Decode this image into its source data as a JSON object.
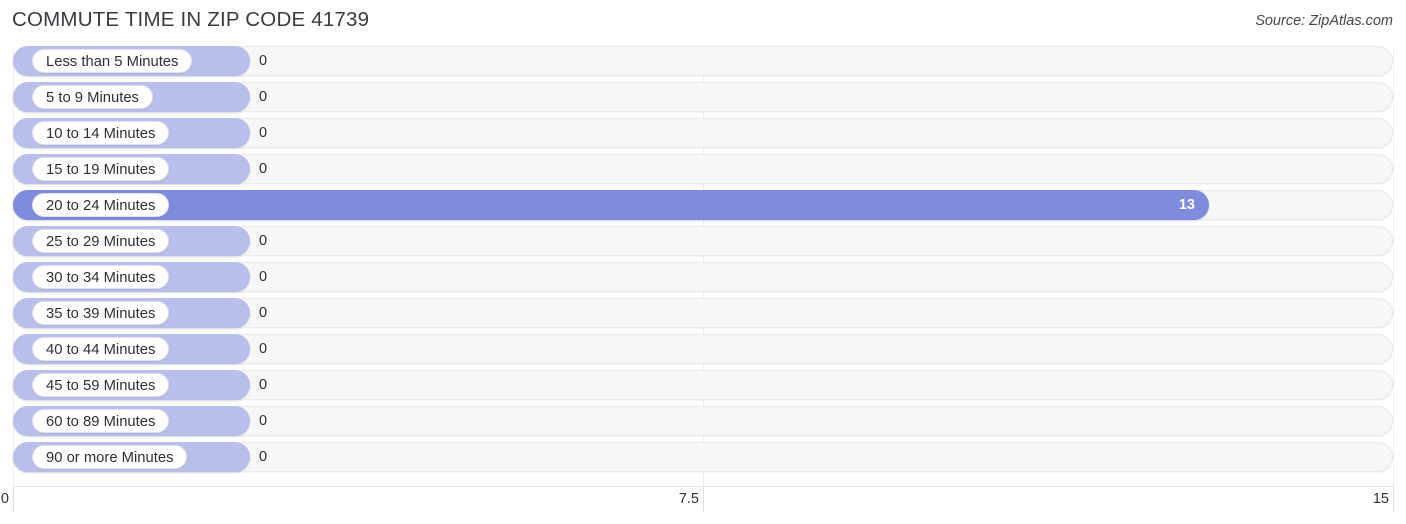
{
  "header": {
    "title": "COMMUTE TIME IN ZIP CODE 41739",
    "source": "Source: ZipAtlas.com"
  },
  "chart_data": {
    "type": "bar",
    "orientation": "horizontal",
    "title": "COMMUTE TIME IN ZIP CODE 41739",
    "xlabel": "",
    "ylabel": "",
    "xlim": [
      0,
      15
    ],
    "xticks": [
      "0",
      "7.5",
      "15"
    ],
    "xtick_values": [
      0,
      7.5,
      15
    ],
    "grid": true,
    "legend": "none",
    "categories": [
      "Less than 5 Minutes",
      "5 to 9 Minutes",
      "10 to 14 Minutes",
      "15 to 19 Minutes",
      "20 to 24 Minutes",
      "25 to 29 Minutes",
      "30 to 34 Minutes",
      "35 to 39 Minutes",
      "40 to 44 Minutes",
      "45 to 59 Minutes",
      "60 to 89 Minutes",
      "90 or more Minutes"
    ],
    "values": [
      0,
      0,
      0,
      0,
      13,
      0,
      0,
      0,
      0,
      0,
      0,
      0
    ],
    "value_labels": [
      "0",
      "0",
      "0",
      "0",
      "13",
      "0",
      "0",
      "0",
      "0",
      "0",
      "0",
      "0"
    ],
    "colors": {
      "bar_zero": "#b9bfeb",
      "bar_filled": "#7f8bdd",
      "track": "#f7f7f7",
      "gridline": "#eeeeee",
      "label_pill_bg": "#ffffff",
      "text": "#2f2f38"
    }
  },
  "rows": [
    {
      "label": "Less than 5 Minutes",
      "value": 0,
      "value_label": "0"
    },
    {
      "label": "5 to 9 Minutes",
      "value": 0,
      "value_label": "0"
    },
    {
      "label": "10 to 14 Minutes",
      "value": 0,
      "value_label": "0"
    },
    {
      "label": "15 to 19 Minutes",
      "value": 0,
      "value_label": "0"
    },
    {
      "label": "20 to 24 Minutes",
      "value": 13,
      "value_label": "13"
    },
    {
      "label": "25 to 29 Minutes",
      "value": 0,
      "value_label": "0"
    },
    {
      "label": "30 to 34 Minutes",
      "value": 0,
      "value_label": "0"
    },
    {
      "label": "35 to 39 Minutes",
      "value": 0,
      "value_label": "0"
    },
    {
      "label": "40 to 44 Minutes",
      "value": 0,
      "value_label": "0"
    },
    {
      "label": "45 to 59 Minutes",
      "value": 0,
      "value_label": "0"
    },
    {
      "label": "60 to 89 Minutes",
      "value": 0,
      "value_label": "0"
    },
    {
      "label": "90 or more Minutes",
      "value": 0,
      "value_label": "0"
    }
  ],
  "axis": {
    "ticks": [
      {
        "label": "0",
        "value": 0
      },
      {
        "label": "7.5",
        "value": 7.5
      },
      {
        "label": "15",
        "value": 15
      }
    ]
  }
}
